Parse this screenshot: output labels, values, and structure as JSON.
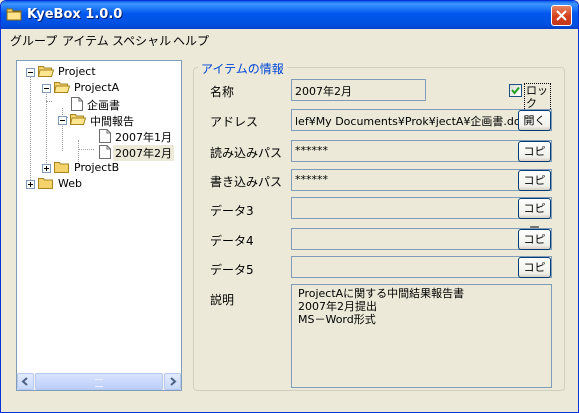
{
  "window": {
    "title": "KyeBox 1.0.0"
  },
  "menu": [
    "グループ",
    "アイテム",
    "スペシャル",
    "ヘルプ"
  ],
  "tree": {
    "root": "Project",
    "projectA": "ProjectA",
    "doc": "企画書",
    "midreport": "中間報告",
    "jan": "2007年1月",
    "feb": "2007年2月",
    "projectB": "ProjectB",
    "web": "Web"
  },
  "item_info": {
    "title": "アイテムの情報",
    "name_label": "名称",
    "name_value": "2007年2月",
    "lock_label": "ロック",
    "lock_checked": true,
    "address_label": "アドレス",
    "address_value": "lef¥My Documents¥Prok¥jectA¥企画書.doc",
    "open_button": "開く",
    "read_pass_label": "読み込みパス",
    "read_pass_value": "******",
    "write_pass_label": "書き込みパス",
    "write_pass_value": "******",
    "data3_label": "データ3",
    "data3_value": "",
    "data4_label": "データ4",
    "data4_value": "",
    "data5_label": "データ5",
    "data5_value": "",
    "copy_button": "コピー",
    "desc_label": "説明",
    "desc_lines": [
      "ProjectAに関する中間結果報告書",
      "2007年2月提出",
      "MS－Word形式"
    ]
  }
}
